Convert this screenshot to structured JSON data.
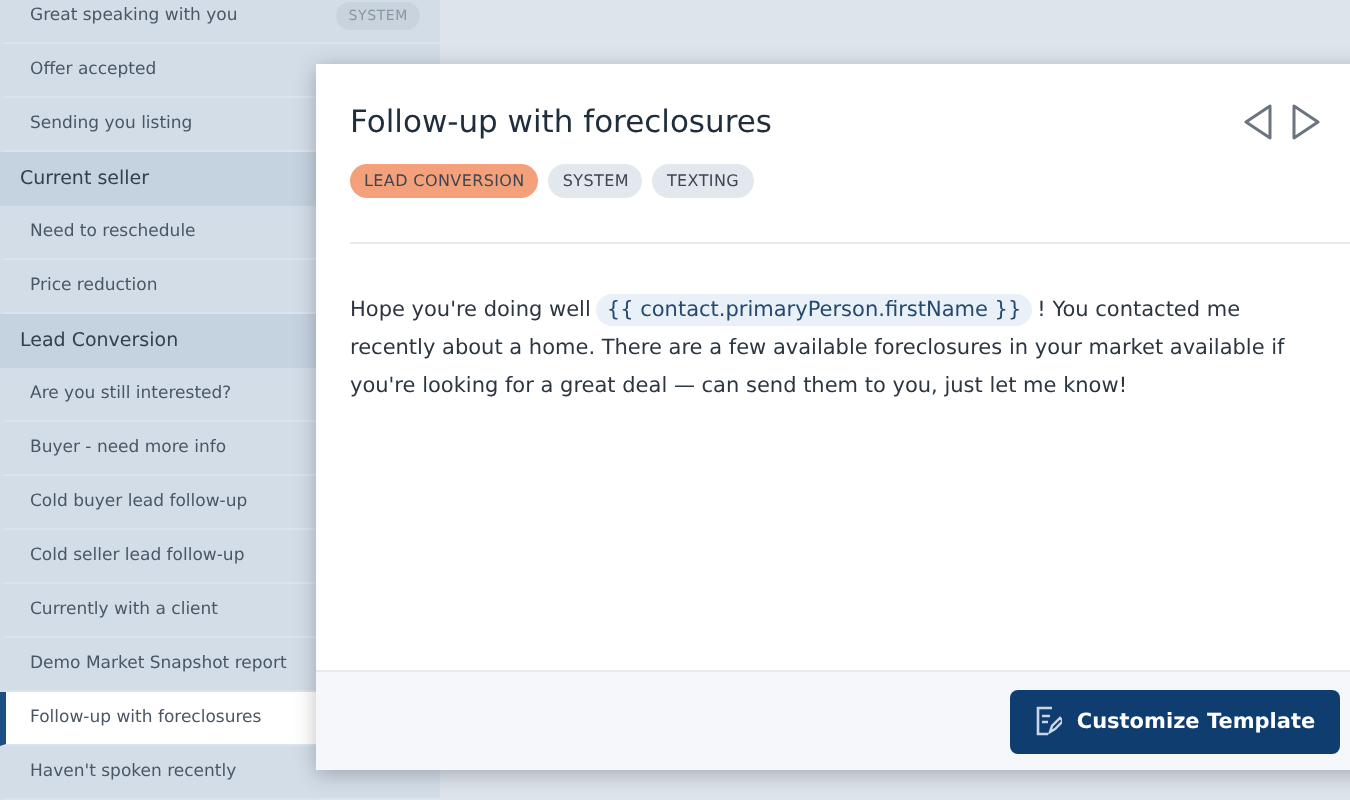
{
  "sidebar": {
    "items": [
      {
        "kind": "item",
        "label": "Great speaking with you",
        "badge": "SYSTEM",
        "selected": false
      },
      {
        "kind": "item",
        "label": "Offer accepted",
        "selected": false
      },
      {
        "kind": "item",
        "label": "Sending you listing",
        "selected": false
      },
      {
        "kind": "header",
        "label": "Current seller"
      },
      {
        "kind": "item",
        "label": "Need to reschedule",
        "selected": false
      },
      {
        "kind": "item",
        "label": "Price reduction",
        "selected": false
      },
      {
        "kind": "header",
        "label": "Lead Conversion"
      },
      {
        "kind": "item",
        "label": "Are you still interested?",
        "selected": false
      },
      {
        "kind": "item",
        "label": "Buyer - need more info",
        "selected": false
      },
      {
        "kind": "item",
        "label": "Cold buyer lead follow-up",
        "selected": false
      },
      {
        "kind": "item",
        "label": "Cold seller lead follow-up",
        "selected": false
      },
      {
        "kind": "item",
        "label": "Currently with a client",
        "selected": false
      },
      {
        "kind": "item",
        "label": "Demo Market Snapshot report",
        "selected": false
      },
      {
        "kind": "item",
        "label": "Follow-up with foreclosures",
        "selected": true
      },
      {
        "kind": "item",
        "label": "Haven't spoken recently",
        "selected": false
      }
    ]
  },
  "modal": {
    "title": "Follow-up with foreclosures",
    "tags": [
      {
        "label": "LEAD CONVERSION",
        "color": "#f4a07a"
      },
      {
        "label": "SYSTEM",
        "color": "#e3e8ee"
      },
      {
        "label": "TEXTING",
        "color": "#e3e8ee"
      }
    ],
    "message": {
      "before": "Hope you're doing well",
      "variable": "{{ contact.primaryPerson.firstName }}",
      "after": "! You contacted me recently about a home. There are a few available foreclosures in your market available if you're looking for a great deal — can send them to you, just let me know!"
    },
    "button": "Customize Template"
  }
}
